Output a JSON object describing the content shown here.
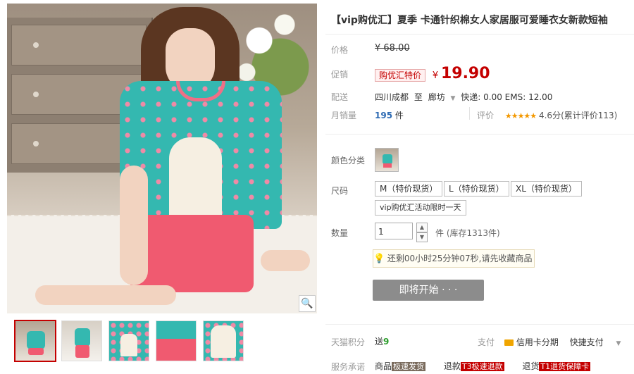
{
  "title": "【vip购优汇】夏季 卡通针织棉女人家居服可爱睡衣女新款短袖",
  "price": {
    "label": "价格",
    "original": "¥ 68.00"
  },
  "promo": {
    "label": "促销",
    "badge": "购优汇特价",
    "currency": "¥",
    "value": "19.90"
  },
  "shipping": {
    "label": "配送",
    "from": "四川成都",
    "to_word": "至",
    "dest": "廊坊",
    "fee": "快递: 0.00 EMS: 12.00"
  },
  "sales": {
    "label": "月销量",
    "count": "195",
    "unit": "件",
    "rating_label": "评价",
    "stars": "★★★★★",
    "rating_text": "4.6分(累计评价113)"
  },
  "color": {
    "label": "颜色分类"
  },
  "size": {
    "label": "尺码",
    "options": [
      "M（特价现货）",
      "L（特价现货）",
      "XL（特价现货）",
      "vip购优汇活动限时一天"
    ]
  },
  "quantity": {
    "label": "数量",
    "value": "1",
    "stock": "件 (库存1313件)",
    "up": "▲",
    "down": "▼"
  },
  "notice": {
    "text": "还剩00小时25分钟07秒,请先收藏商品"
  },
  "buy_button": "即将开始 · · ·",
  "points": {
    "label": "天猫积分",
    "prefix": "送",
    "value": "9"
  },
  "payment": {
    "label": "支付",
    "card": "信用卡分期",
    "fast": "快捷支付",
    "arrow": "▼"
  },
  "service": {
    "label": "服务承诺",
    "item1_pre": "商品",
    "item1_tag": "极速发货",
    "item2_pre": "退款",
    "item2_tag": "T3极速退款",
    "item3_pre": "退货",
    "item3_tag": "T1退货保障卡"
  },
  "icons": {
    "zoom": "🔍",
    "bulb": "💡",
    "card": "card-icon"
  },
  "colors": {
    "accent": "#c40000",
    "teal": "#34b8b0",
    "pink": "#f05a70"
  }
}
